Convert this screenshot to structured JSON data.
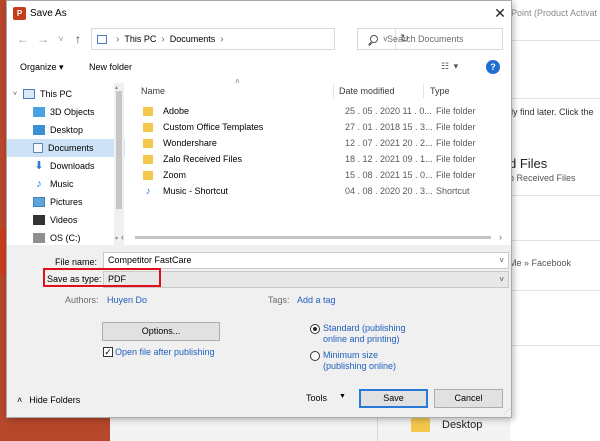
{
  "background": {
    "title_fragment": "Point (Product Activat",
    "hint_text": "ily find later. Click the",
    "heading": "d Files",
    "subheading": "o Received Files",
    "path_text": "Me » Facebook",
    "desktop_label": "Desktop"
  },
  "dialog": {
    "app_icon": "P",
    "title": "Save As",
    "close_icon": "✕"
  },
  "nav": {
    "back": "←",
    "forward": "→",
    "recent": "˅",
    "up": "↑"
  },
  "address": {
    "crumbs": [
      "This PC",
      "Documents"
    ],
    "sep": "›",
    "dropdown": "˅",
    "refresh": "↻"
  },
  "search": {
    "placeholder": "Search Documents"
  },
  "toolbar": {
    "organize": "Organize ▾",
    "new_folder": "New folder",
    "view": "☷ ▾",
    "help": "?"
  },
  "sidebar": {
    "items": [
      {
        "label": "This PC",
        "icon": "pc-icon",
        "chev": "˅"
      },
      {
        "label": "3D Objects",
        "icon": "3d-objects-icon",
        "chev": ""
      },
      {
        "label": "Desktop",
        "icon": "desktop-icon",
        "chev": ""
      },
      {
        "label": "Documents",
        "icon": "documents-icon",
        "chev": ""
      },
      {
        "label": "Downloads",
        "icon": "downloads-icon",
        "chev": ""
      },
      {
        "label": "Music",
        "icon": "music-icon",
        "chev": ""
      },
      {
        "label": "Pictures",
        "icon": "pictures-icon",
        "chev": ""
      },
      {
        "label": "Videos",
        "icon": "videos-icon",
        "chev": ""
      },
      {
        "label": "OS (C:)",
        "icon": "drive-icon",
        "chev": ""
      }
    ],
    "down_glyph": "⬇",
    "music_glyph": "♪"
  },
  "columns": {
    "name": "Name",
    "date": "Date modified",
    "type": "Type",
    "sort_arrow": "˄"
  },
  "files": [
    {
      "name": "Adobe",
      "date": "25 . 05 . 2020 11 . 0...",
      "type": "File folder",
      "kind": "folder"
    },
    {
      "name": "Custom Office Templates",
      "date": "27 . 01 . 2018 15 . 3...",
      "type": "File folder",
      "kind": "folder"
    },
    {
      "name": "Wondershare",
      "date": "12 . 07 . 2021 20 . 2...",
      "type": "File folder",
      "kind": "folder"
    },
    {
      "name": "Zalo Received Files",
      "date": "18 . 12 . 2021 09 . 1...",
      "type": "File folder",
      "kind": "folder"
    },
    {
      "name": "Zoom",
      "date": "15 . 08 . 2021 15 . 0...",
      "type": "File folder",
      "kind": "folder"
    },
    {
      "name": "Music - Shortcut",
      "date": "04 . 08 . 2020 20 . 3...",
      "type": "Shortcut",
      "kind": "shortcut"
    }
  ],
  "scroll": {
    "left": "‹",
    "right": "›",
    "up": "▴",
    "down": "▾"
  },
  "form": {
    "file_name_label": "File name:",
    "file_name_value": "Competitor FastCare",
    "save_type_label": "Save as type:",
    "save_type_value": "PDF",
    "drop": "˅",
    "authors_label": "Authors:",
    "authors_value": "Huyen Do",
    "tags_label": "Tags:",
    "tags_value": "Add a tag",
    "options_button": "Options...",
    "open_after_label": "Open file after publishing",
    "open_after_checked": "✓",
    "radio_standard": "Standard (publishing online and printing)",
    "radio_minimum": "Minimum size (publishing online)",
    "hide_folders": "Hide Folders",
    "hide_chev": "˄",
    "tools_label": "Tools",
    "tools_arrow": "▼",
    "save_button": "Save",
    "cancel_button": "Cancel"
  },
  "colors": {
    "ppt_accent": "#c43e1c",
    "highlight_box": "#e0101a",
    "link": "#1f5fbf",
    "selected_nav": "#cde1f7"
  }
}
